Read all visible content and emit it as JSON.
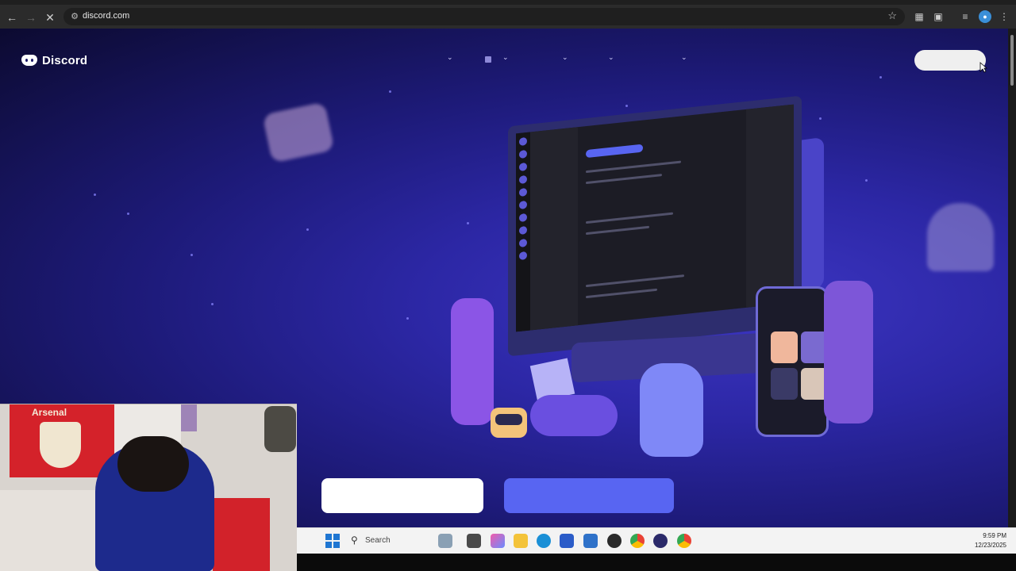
{
  "browser": {
    "url": "discord.com"
  },
  "page": {
    "brand": "Discord"
  },
  "taskbar": {
    "search_placeholder": "Search",
    "time": "9:59 PM",
    "date": "12/23/2025"
  },
  "webcam": {
    "flag_text": "Arsenal"
  },
  "colors": {
    "blurple": "#5865f2",
    "hero_bg": "#2c27a5"
  }
}
